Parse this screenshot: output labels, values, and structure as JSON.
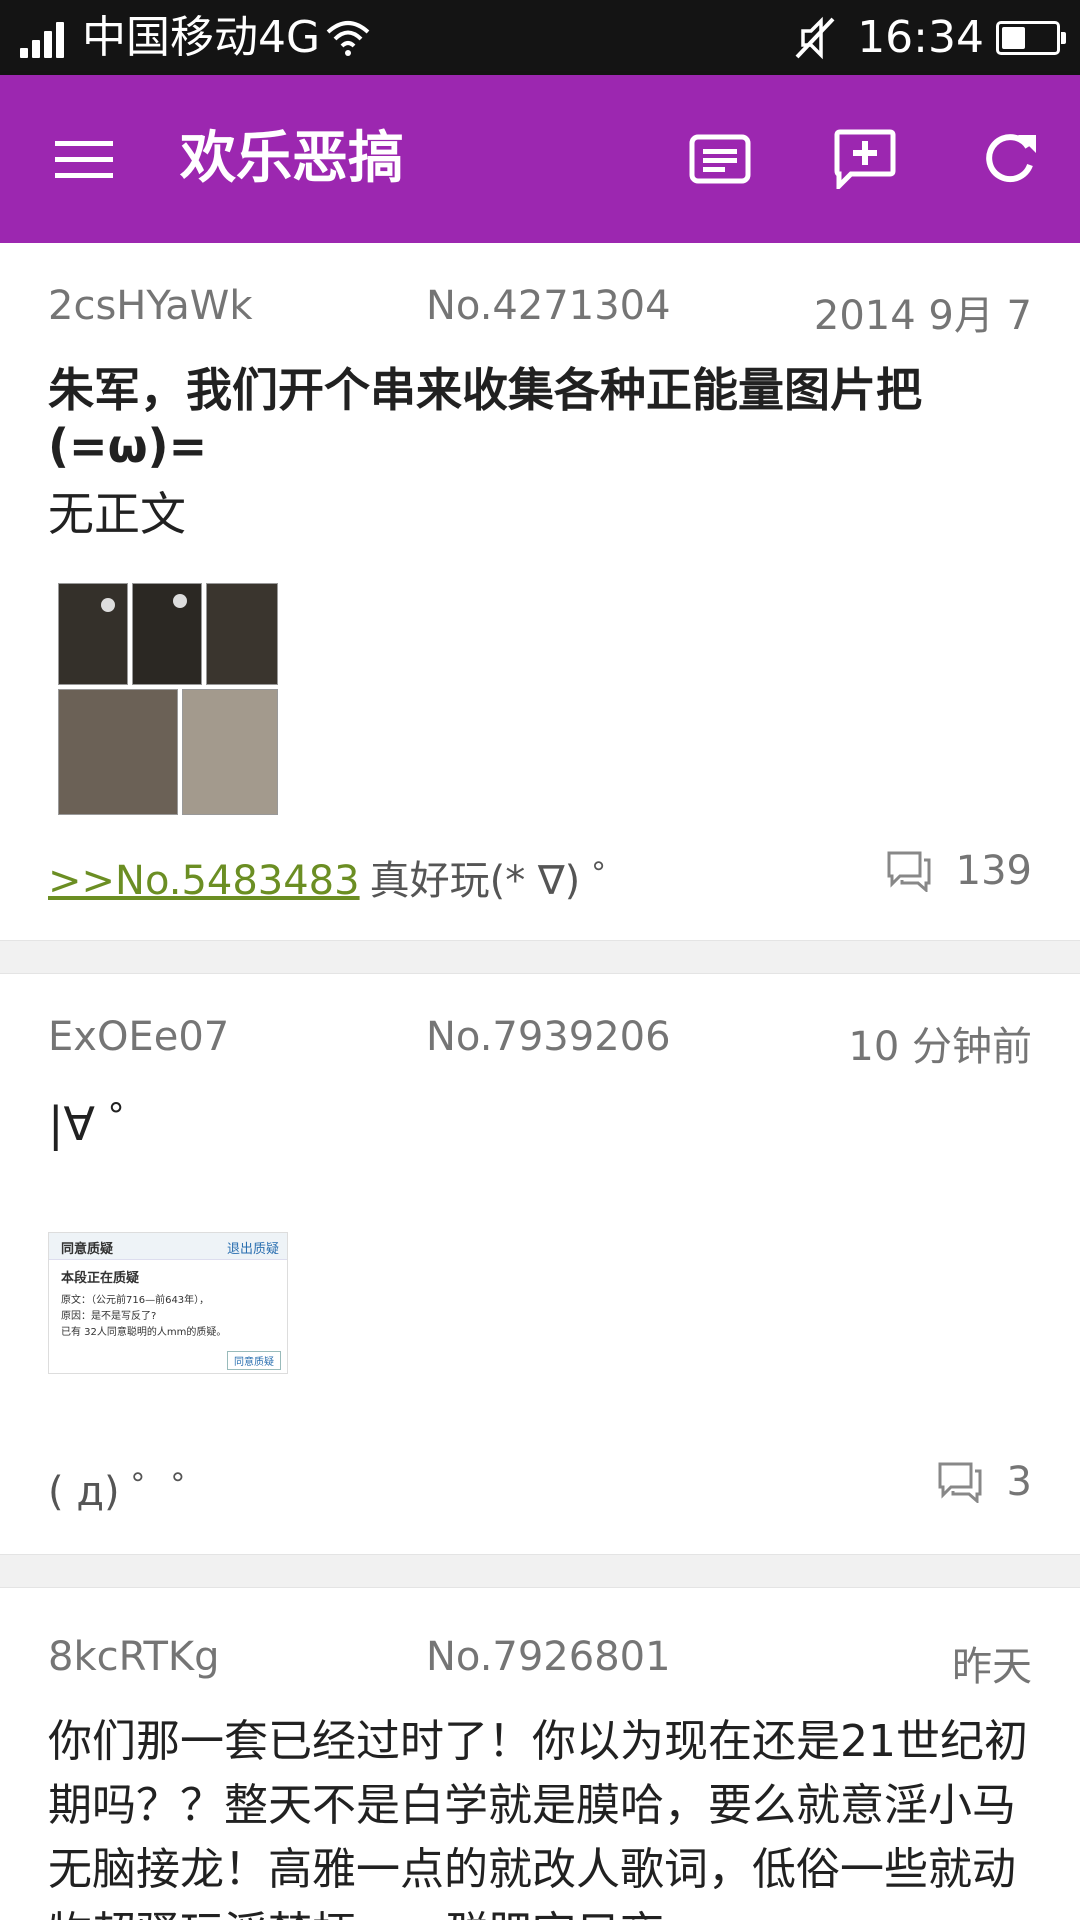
{
  "status_bar": {
    "carrier": "中国移动4G",
    "time": "16:34",
    "battery_level": 0.45
  },
  "app_bar": {
    "title": "欢乐恶搞",
    "icons": [
      "menu-icon",
      "list-icon",
      "add-comment-icon",
      "refresh-icon"
    ],
    "color": "#9c27b0"
  },
  "posts": [
    {
      "uid": "2csHYaWk",
      "no": "No.4271304",
      "time": "2014 9月 7",
      "title": "朱军，我们开个串来收集各种正能量图片把(=ω)=",
      "body": "无正文",
      "reply_link": ">>No.5483483",
      "reply_text": "真好玩(* ∇) ゜",
      "comments": "139"
    },
    {
      "uid": "ExOEe07",
      "no": "No.7939206",
      "time": "10 分钟前",
      "body": "|∀ ゜",
      "image_texts": {
        "header_left": "同意质疑",
        "header_right": "退出质疑",
        "line1": "本段正在质疑",
        "line2": "原文：（公元前716—前643年），",
        "line3": "原因：是不是写反了?",
        "line4": "已有 32人同意聪明的人mm的质疑。",
        "button": "同意质疑"
      },
      "footer_text": "( д) ゜゜",
      "comments": "3"
    },
    {
      "uid": "8kcRTKg",
      "no": "No.7926801",
      "time": "昨天",
      "body": "你们那一套已经过时了！你以为现在还是21世纪初期吗？？整天不是白学就是膜哈，要么就意淫小马无脑接龙！高雅一点的就改人歌词，低俗一些就动物超骚玩淫梦梗，一群肥宅只夜"
    }
  ]
}
